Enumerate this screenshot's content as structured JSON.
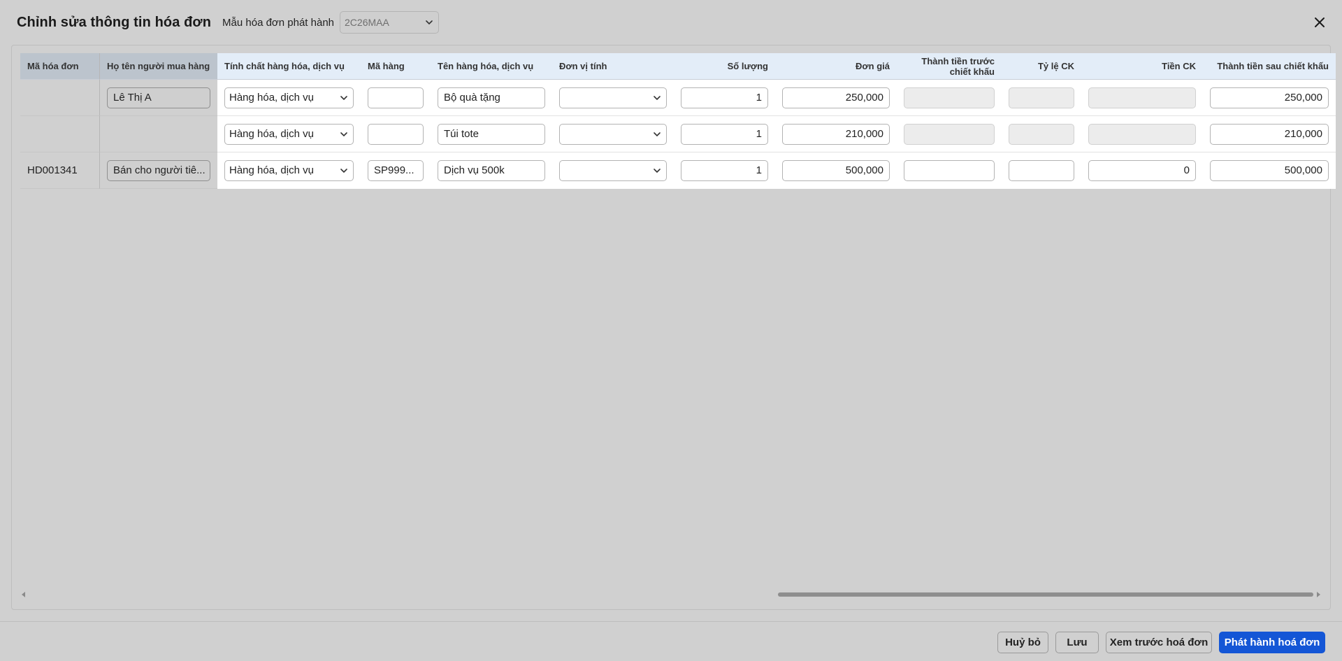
{
  "header": {
    "title": "Chỉnh sửa thông tin hóa đơn",
    "template_label": "Mẫu hóa đơn phát hành",
    "template_value": "2C26MAA"
  },
  "table": {
    "columns": {
      "invoice_code": "Mã hóa đơn",
      "buyer_name": "Họ tên người mua hàng",
      "item_type": "Tính chất hàng hóa, dịch vụ",
      "item_code": "Mã hàng",
      "item_name": "Tên hàng hóa, dịch vụ",
      "unit": "Đơn vị tính",
      "quantity": "Số lượng",
      "unit_price": "Đơn giá",
      "pre_discount_line1": "Thành tiền trước",
      "pre_discount_line2": "chiết khấu",
      "discount_rate": "Tỷ lệ CK",
      "discount_amount": "Tiền CK",
      "total_after_discount": "Thành tiền sau chiết khấu"
    },
    "rows": [
      {
        "invoice_code": "",
        "buyer_name": "Lê Thị A",
        "item_type": "Hàng hóa, dịch vụ",
        "item_code": "",
        "item_name": "Bộ quà tặng",
        "unit": "",
        "quantity": "1",
        "unit_price": "250,000",
        "pre_discount": "",
        "discount_rate": "",
        "discount_amount": "",
        "total_after_discount": "250,000"
      },
      {
        "invoice_code": "",
        "buyer_name": "",
        "item_type": "Hàng hóa, dịch vụ",
        "item_code": "",
        "item_name": "Túi tote",
        "unit": "",
        "quantity": "1",
        "unit_price": "210,000",
        "pre_discount": "",
        "discount_rate": "",
        "discount_amount": "",
        "total_after_discount": "210,000"
      },
      {
        "invoice_code": "HD001341",
        "buyer_name": "Bán cho người tiê...",
        "item_type": "Hàng hóa, dịch vụ",
        "item_code": "SP999...",
        "item_name": "Dịch vụ 500k",
        "unit": "",
        "quantity": "1",
        "unit_price": "500,000",
        "pre_discount": "",
        "discount_rate": "",
        "discount_amount": "0",
        "total_after_discount": "500,000"
      }
    ]
  },
  "footer": {
    "cancel": "Huỷ bỏ",
    "save": "Lưu",
    "preview": "Xem trước hoá đơn",
    "issue": "Phát hành hoá đơn"
  },
  "icons": {
    "close": "close-icon",
    "dropdown": "chevron-down-icon",
    "scroll_left": "arrow-left-icon",
    "scroll_right": "arrow-right-icon"
  },
  "colors": {
    "primary": "#1456d6",
    "header_fixed": "#bcc4cd",
    "header_scroll": "#e3edf8",
    "overlay": "#d0d0d0"
  }
}
